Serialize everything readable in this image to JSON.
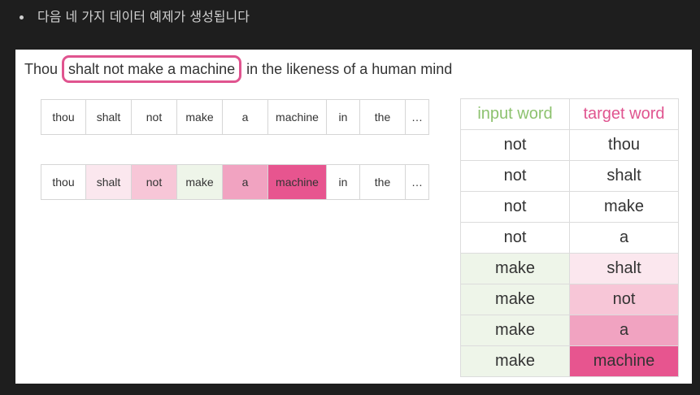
{
  "bullet": {
    "text": "다음 네 가지 데이터 예제가 생성됩니다"
  },
  "sentence": {
    "prefix": "Thou ",
    "highlight": "shalt not make a machine",
    "suffix": " in the likeness of a human mind"
  },
  "colors": {
    "highlight_border": "#e0548f",
    "input_green": "#8dc26f",
    "pink_1": "#fbe7ee",
    "pink_2": "#f7c6d7",
    "pink_3": "#f1a3c1",
    "pink_4": "#e7558f",
    "green_light": "#eef5e9"
  },
  "row1": {
    "tokens": [
      "thou",
      "shalt",
      "not",
      "make",
      "a",
      "machine",
      "in",
      "the",
      "…"
    ]
  },
  "row2": {
    "tokens": [
      "thou",
      "shalt",
      "not",
      "make",
      "a",
      "machine",
      "in",
      "the",
      "…"
    ]
  },
  "table": {
    "header_input": "input word",
    "header_target": "target word",
    "rows": [
      {
        "input": "not",
        "target": "thou"
      },
      {
        "input": "not",
        "target": "shalt"
      },
      {
        "input": "not",
        "target": "make"
      },
      {
        "input": "not",
        "target": "a"
      },
      {
        "input": "make",
        "target": "shalt"
      },
      {
        "input": "make",
        "target": "not"
      },
      {
        "input": "make",
        "target": "a"
      },
      {
        "input": "make",
        "target": "machine"
      }
    ]
  }
}
